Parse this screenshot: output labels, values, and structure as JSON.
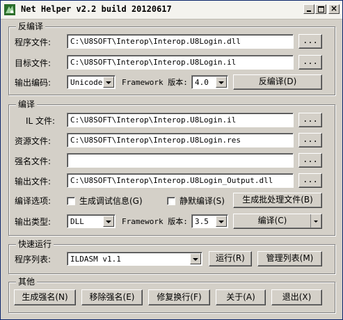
{
  "window": {
    "title": "Net Helper v2.2 build 20120617"
  },
  "decompile": {
    "legend": "反编译",
    "program_file_label": "程序文件:",
    "program_file_value": "C:\\U8SOFT\\Interop\\Interop.U8Login.dll",
    "target_file_label": "目标文件:",
    "target_file_value": "C:\\U8SOFT\\Interop\\Interop.U8Login.il",
    "browse_label": "...",
    "encoding_label": "输出编码:",
    "encoding_value": "Unicode",
    "framework_label": "Framework 版本:",
    "framework_value": "4.0",
    "decompile_button": "反编译(D)"
  },
  "compile": {
    "legend": "编译",
    "il_file_label": "IL 文件:",
    "il_file_value": "C:\\U8SOFT\\Interop\\Interop.U8Login.il",
    "resource_file_label": "资源文件:",
    "resource_file_value": "C:\\U8SOFT\\Interop\\Interop.U8Login.res",
    "strongname_file_label": "强名文件:",
    "strongname_file_value": "",
    "output_file_label": "输出文件:",
    "output_file_value": "C:\\U8SOFT\\Interop\\Interop.U8Login_Output.dll",
    "browse_label": "...",
    "options_label": "编译选项:",
    "debug_info_label": "生成调试信息(G)",
    "silent_compile_label": "静默编译(S)",
    "batch_button": "生成批处理文件(B)",
    "output_type_label": "输出类型:",
    "output_type_value": "DLL",
    "framework_label": "Framework 版本:",
    "framework_value": "3.5",
    "compile_button": "编译(C)"
  },
  "quickrun": {
    "legend": "快速运行",
    "program_list_label": "程序列表:",
    "program_list_value": "ILDASM v1.1",
    "run_button": "运行(R)",
    "manage_button": "管理列表(M)"
  },
  "other": {
    "legend": "其他",
    "buttons": [
      "生成强名(N)",
      "移除强名(E)",
      "修复换行(F)",
      "关于(A)",
      "退出(X)"
    ]
  },
  "colors": {
    "chrome": "#d4d0c8",
    "title_bg": "#f4f3ee"
  }
}
